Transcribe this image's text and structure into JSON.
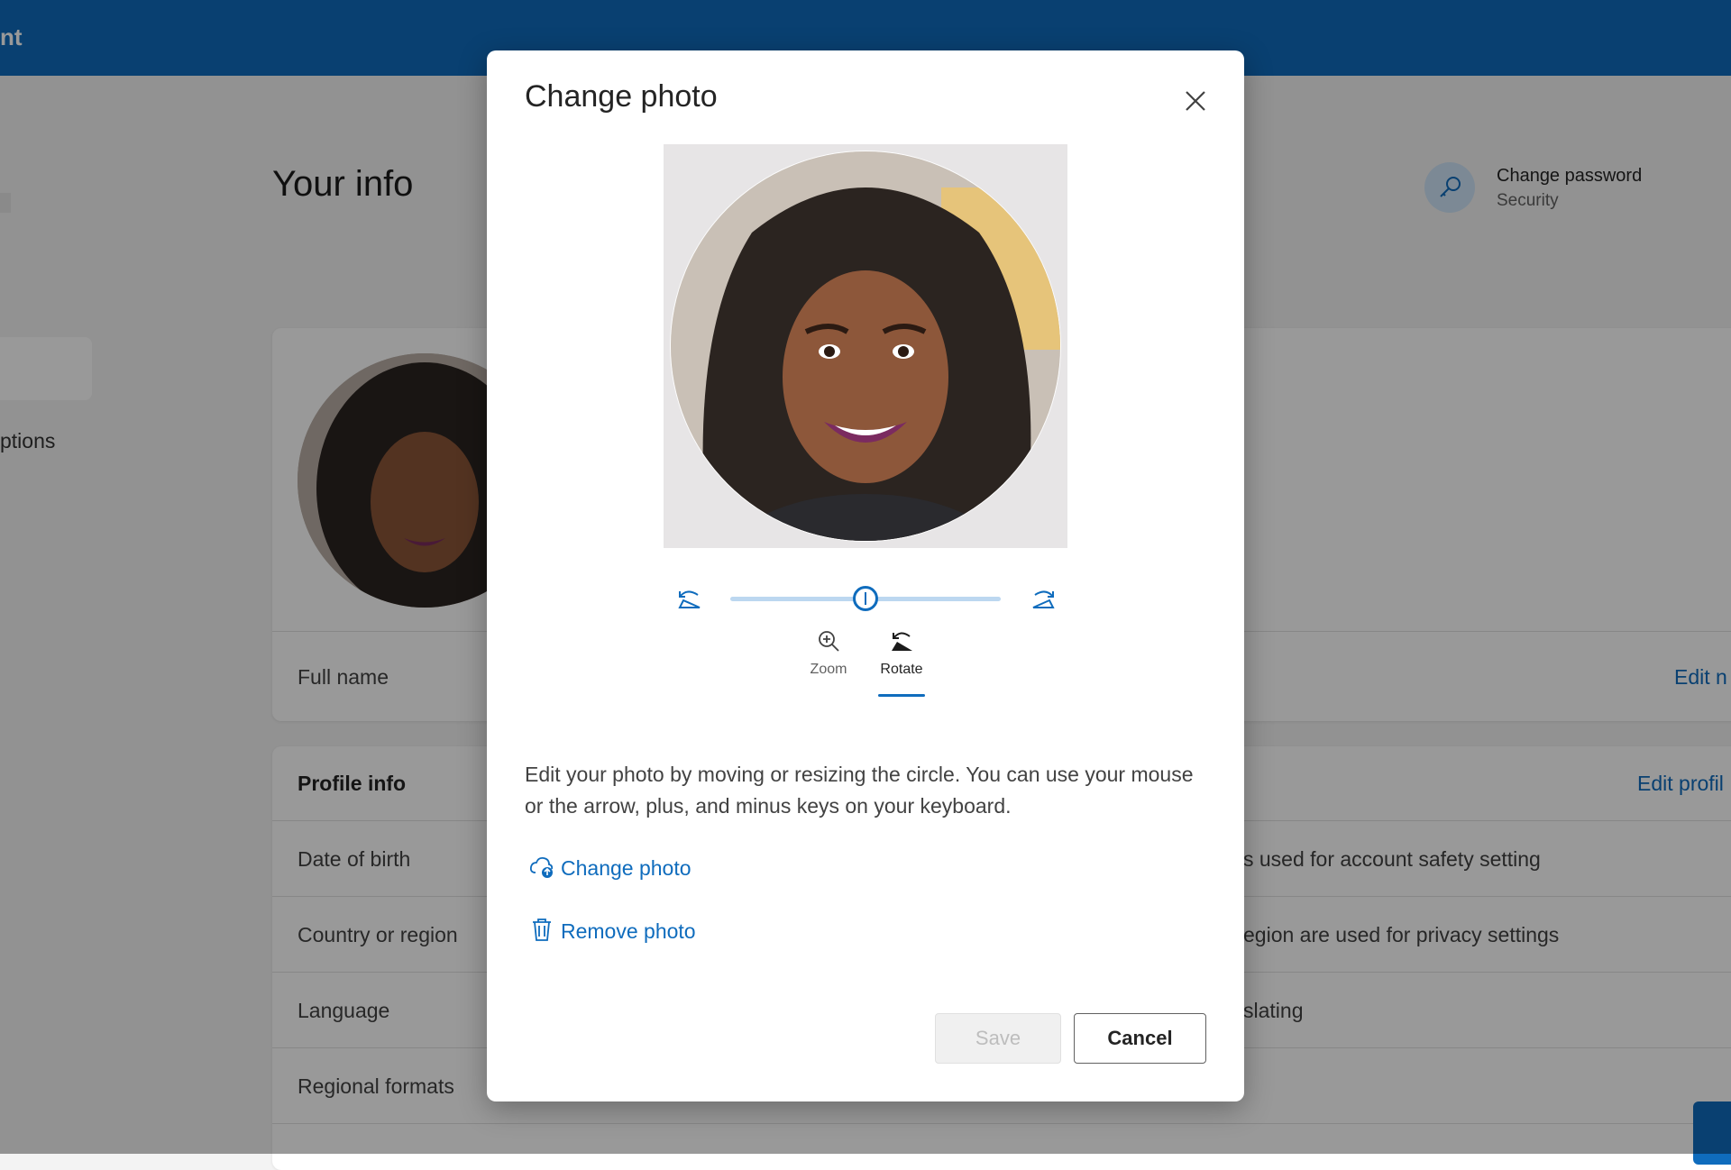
{
  "header": {
    "brand_fragment": "nt"
  },
  "page": {
    "title": "Your info"
  },
  "sidebar": {
    "item_fragment": "ptions"
  },
  "side_action": {
    "title": "Change password",
    "subtitle": "Security"
  },
  "card1": {
    "row_label": "Full name",
    "row_link": "Edit n"
  },
  "card2": {
    "title": "Profile info",
    "edit_link": "Edit profil",
    "rows": [
      {
        "label": "Date of birth",
        "note": "s used for account safety setting"
      },
      {
        "label": "Country or region",
        "note": "egion are used for privacy settings"
      },
      {
        "label": "Language",
        "note": "slating"
      },
      {
        "label": "Regional formats",
        "note": ""
      }
    ]
  },
  "dialog": {
    "title": "Change photo",
    "slider_position": 0.5,
    "tabs": [
      {
        "label": "Zoom",
        "active": false
      },
      {
        "label": "Rotate",
        "active": true
      }
    ],
    "help_text": "Edit your photo by moving or resizing the circle. You can use your mouse or the arrow, plus, and minus keys on your keyboard.",
    "change_photo_label": "Change photo",
    "remove_photo_label": "Remove photo",
    "save_label": "Save",
    "cancel_label": "Cancel"
  },
  "colors": {
    "accent": "#0f6cbd",
    "header": "#0f6cbd"
  }
}
